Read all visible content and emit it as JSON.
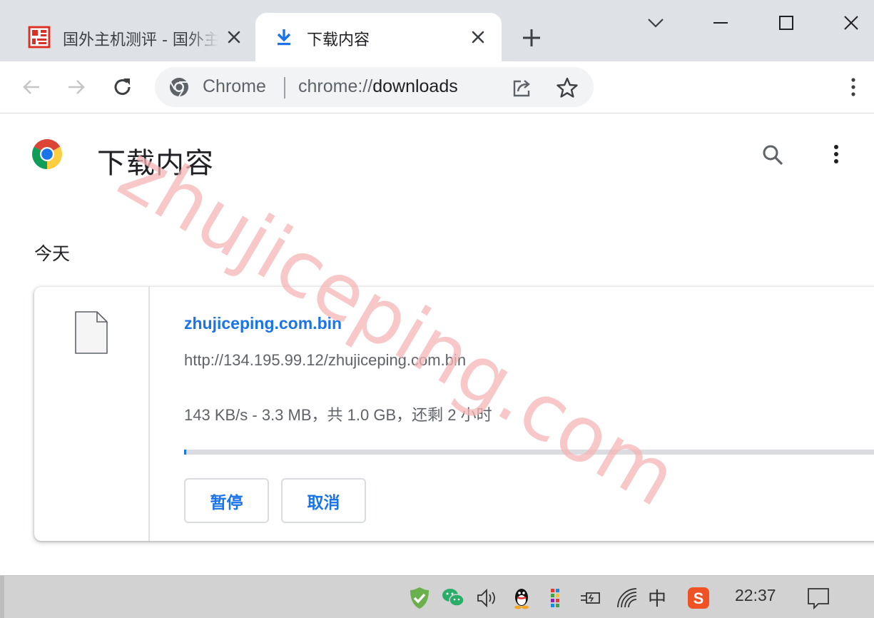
{
  "tabs": [
    {
      "label": "国外主机测评 - 国外主机测评"
    },
    {
      "label": "下载内容"
    }
  ],
  "toolbar": {
    "site_chip": "Chrome",
    "url_scheme": "chrome://",
    "url_host": "downloads"
  },
  "page": {
    "title": "下载内容",
    "section_date": "今天"
  },
  "download": {
    "file_name": "zhujiceping.com.bin",
    "source_url": "http://134.195.99.12/zhujiceping.com.bin",
    "status": "143 KB/s - 3.3 MB，共 1.0 GB，还剩 2 小时",
    "progress_fraction": 0.003,
    "pause_label": "暂停",
    "cancel_label": "取消"
  },
  "watermark": "zhujiceping.com",
  "taskbar": {
    "ime": "中",
    "clock": "22:37"
  },
  "colors": {
    "accent": "#1a73e8",
    "tabstrip": "#dee1e6",
    "watermark": "#f5b5b5"
  }
}
